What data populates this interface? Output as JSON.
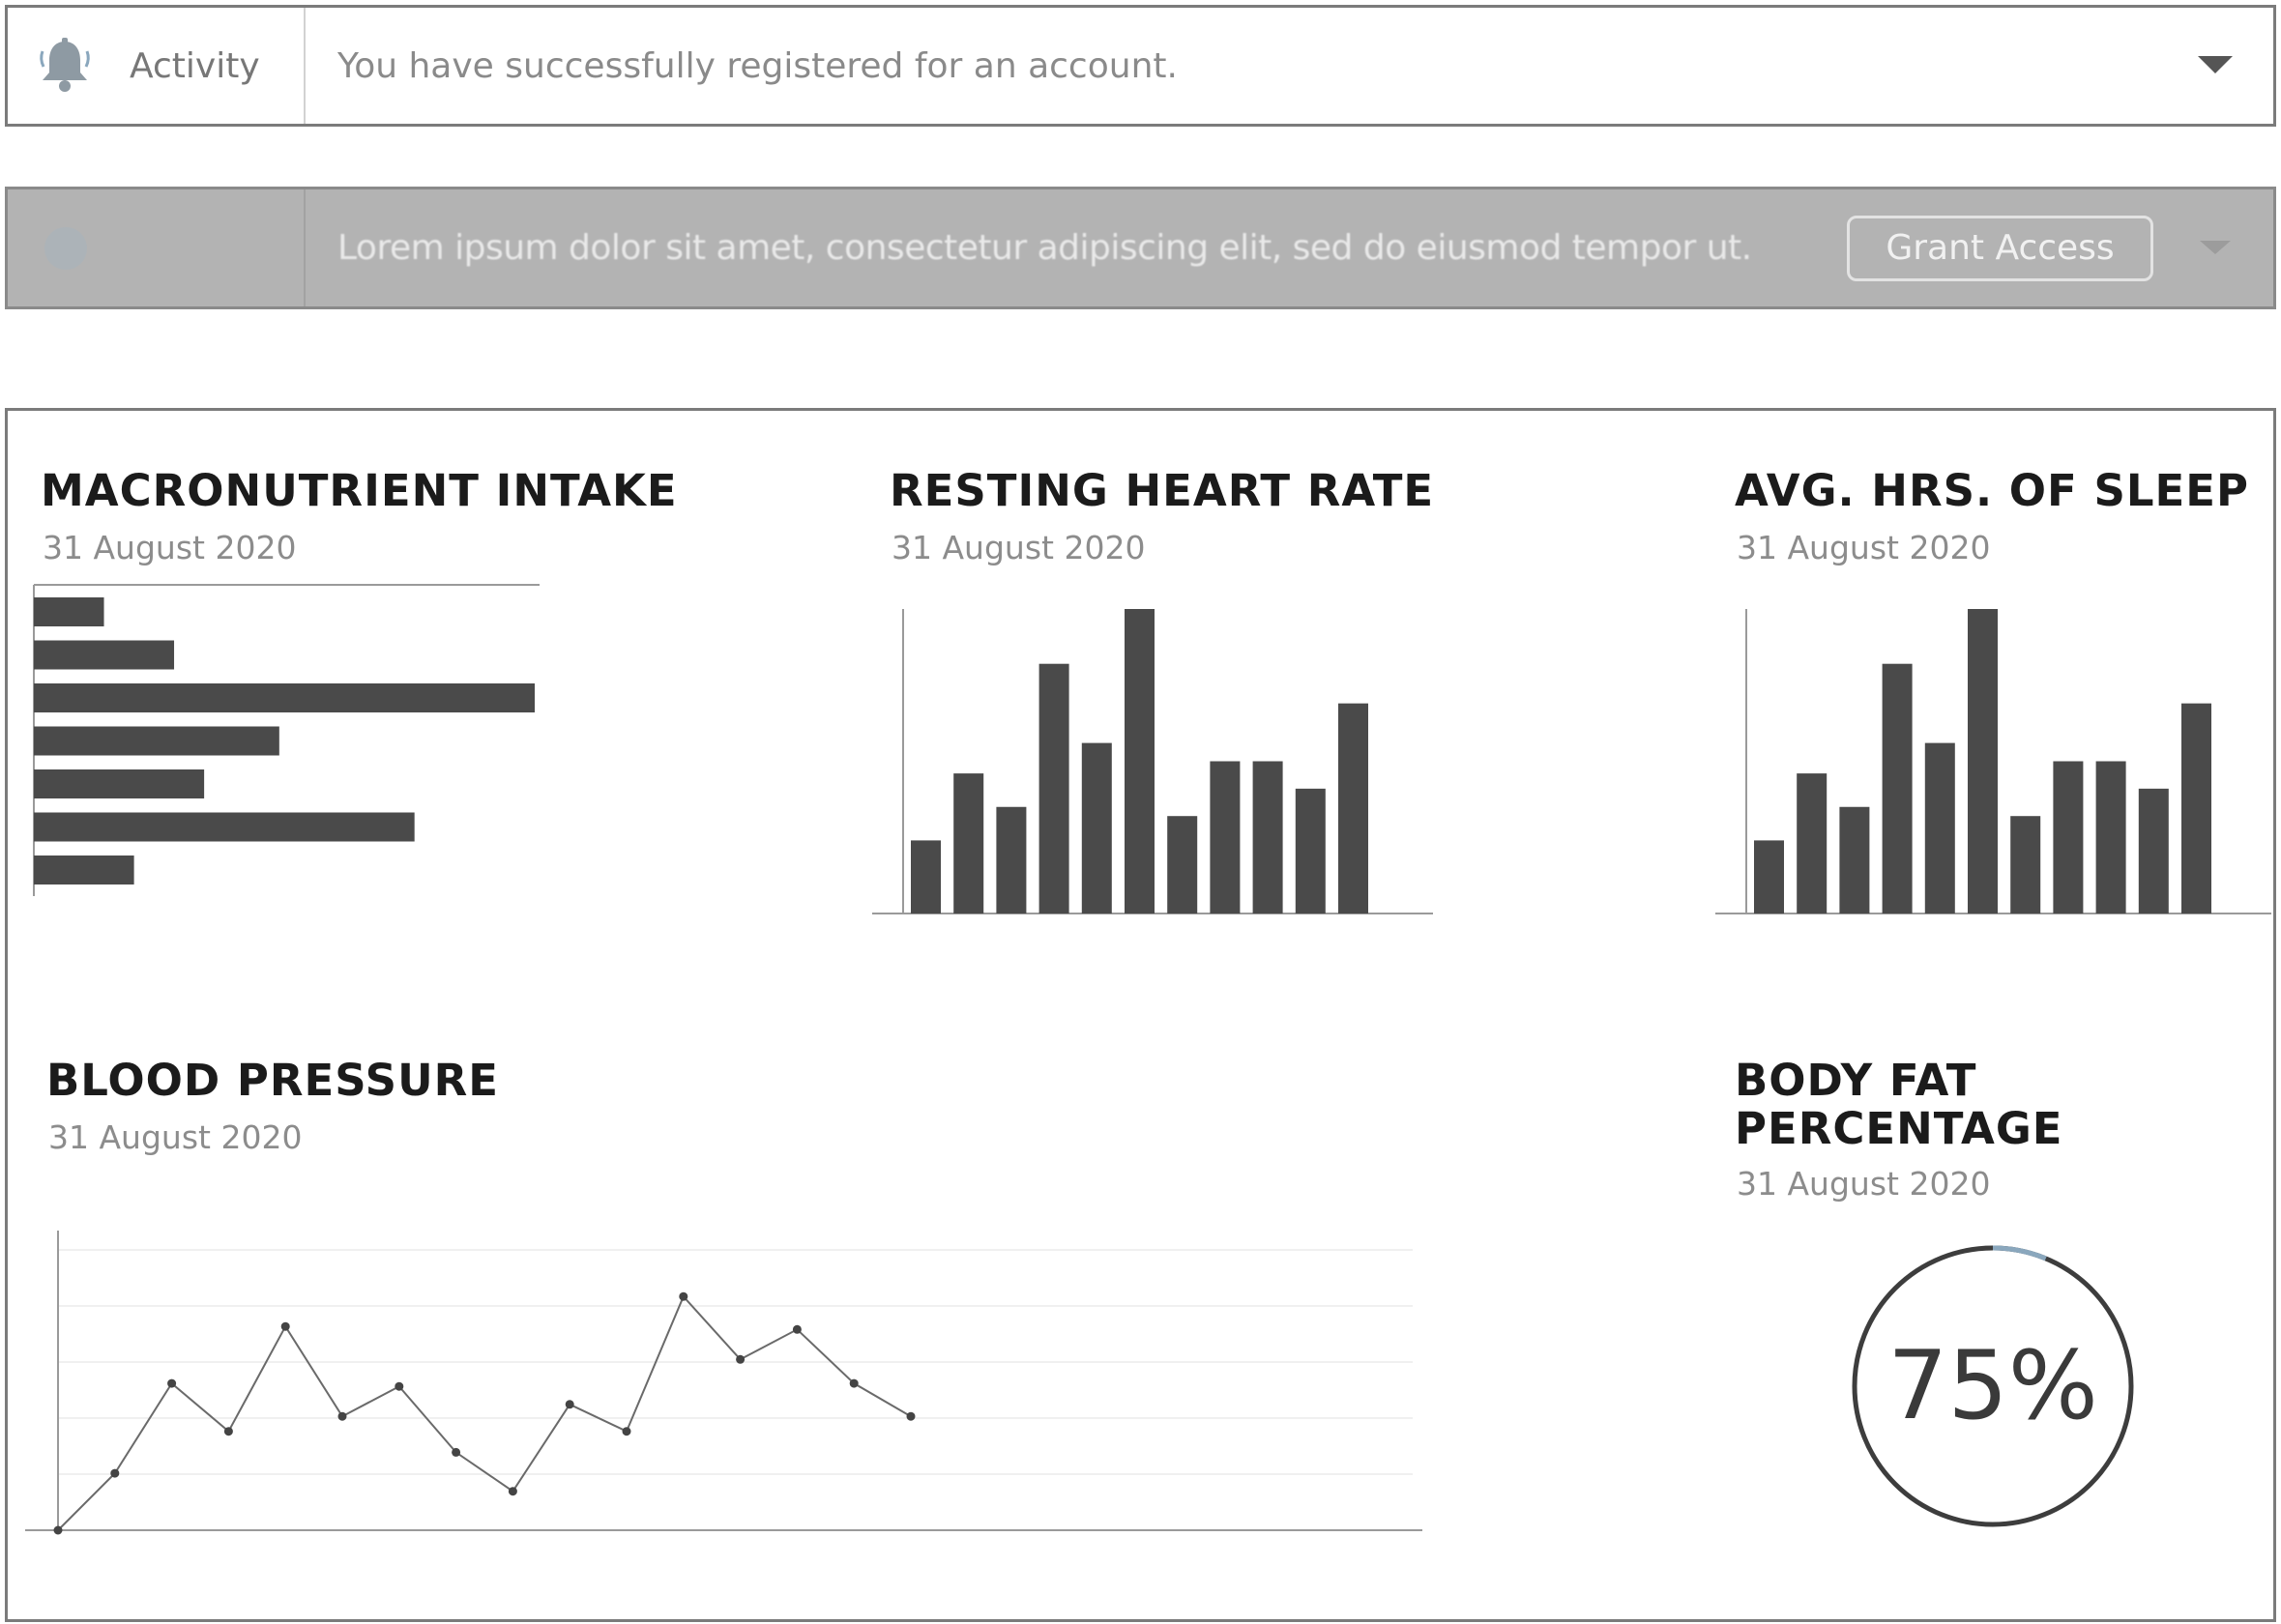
{
  "notification": {
    "label": "Activity",
    "message": "You have successfully registered for an account."
  },
  "access_request": {
    "message": "Lorem ipsum dolor sit amet, consectetur adipiscing elit, sed do eiusmod tempor ut.",
    "button_label": "Grant Access"
  },
  "dashboard": {
    "macro": {
      "title": "MACRONUTRIENT INTAKE",
      "date": "31 August 2020"
    },
    "heart": {
      "title": "RESTING HEART RATE",
      "date": "31 August 2020"
    },
    "sleep": {
      "title": "AVG. HRS. OF SLEEP",
      "date": "31 August 2020"
    },
    "bp": {
      "title": "BLOOD PRESSURE",
      "date": "31 August 2020"
    },
    "bodyfat": {
      "title_line1": "BODY FAT",
      "title_line2": "PERCENTAGE",
      "date": "31 August 2020",
      "value_text": "75%"
    }
  },
  "colors": {
    "bar": "#4a4a4a",
    "axis": "#9a9a9a",
    "gauge_stroke": "#3d3d3d",
    "gauge_accent": "#8aa7bd"
  },
  "chart_data": [
    {
      "id": "macro",
      "type": "bar",
      "orientation": "horizontal",
      "values": [
        14,
        28,
        100,
        49,
        34,
        76,
        20
      ],
      "ylim": [
        0,
        100
      ]
    },
    {
      "id": "heart",
      "type": "bar",
      "values": [
        24,
        46,
        35,
        82,
        56,
        100,
        32,
        50,
        50,
        41,
        69
      ],
      "ylim": [
        0,
        100
      ]
    },
    {
      "id": "sleep",
      "type": "bar",
      "values": [
        24,
        46,
        35,
        82,
        56,
        100,
        32,
        50,
        50,
        41,
        69
      ],
      "ylim": [
        0,
        100
      ]
    },
    {
      "id": "bp",
      "type": "line",
      "values": [
        0,
        19,
        49,
        33,
        68,
        38,
        48,
        26,
        13,
        42,
        33,
        78,
        57,
        67,
        49,
        38
      ],
      "ylim": [
        0,
        100
      ],
      "grid": true
    },
    {
      "id": "bodyfat",
      "type": "gauge",
      "value": 75
    }
  ]
}
